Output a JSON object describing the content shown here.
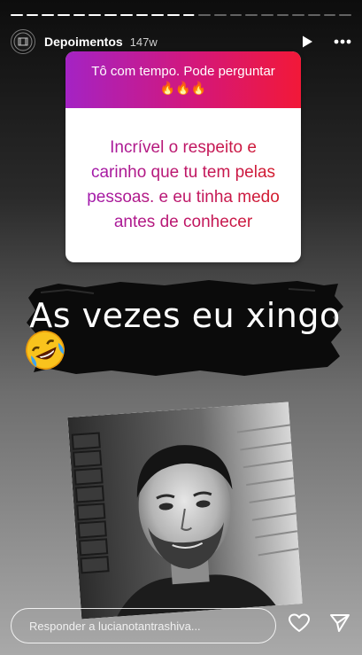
{
  "story": {
    "progress_segments": [
      {
        "filled": 1
      },
      {
        "filled": 1
      },
      {
        "filled": 1
      },
      {
        "filled": 1
      },
      {
        "filled": 1
      },
      {
        "filled": 1
      },
      {
        "filled": 1
      },
      {
        "filled": 1
      },
      {
        "filled": 1
      },
      {
        "filled": 1
      },
      {
        "filled": 1
      },
      {
        "filled": 0.9
      },
      {
        "filled": 0
      },
      {
        "filled": 0
      },
      {
        "filled": 0
      },
      {
        "filled": 0
      },
      {
        "filled": 0
      },
      {
        "filled": 0
      },
      {
        "filled": 0
      },
      {
        "filled": 0
      },
      {
        "filled": 0
      },
      {
        "filled": 0
      }
    ]
  },
  "header": {
    "account_name": "Depoimentos",
    "time_ago": "147w",
    "play_icon": "play-icon",
    "more_icon": "more-horizontal-icon"
  },
  "question_card": {
    "prompt": "Tô com tempo. Pode perguntar",
    "prompt_emojis": "🔥🔥🔥",
    "answer": "Incrível o respeito e carinho que tu tem pelas pessoas. e eu tinha medo antes de conhecer",
    "colors": {
      "gradient_start": "#a423c4",
      "gradient_mid": "#d4177a",
      "gradient_end": "#f21838"
    }
  },
  "caption": {
    "text": "As vezes eu xingo",
    "emojis": [
      "rolling-on-floor-laughing",
      "rolling-on-floor-laughing",
      "rolling-on-floor-laughing"
    ]
  },
  "reply_bar": {
    "placeholder": "Responder a lucianotantrashiva...",
    "like_icon": "heart-icon",
    "send_icon": "send-icon"
  }
}
